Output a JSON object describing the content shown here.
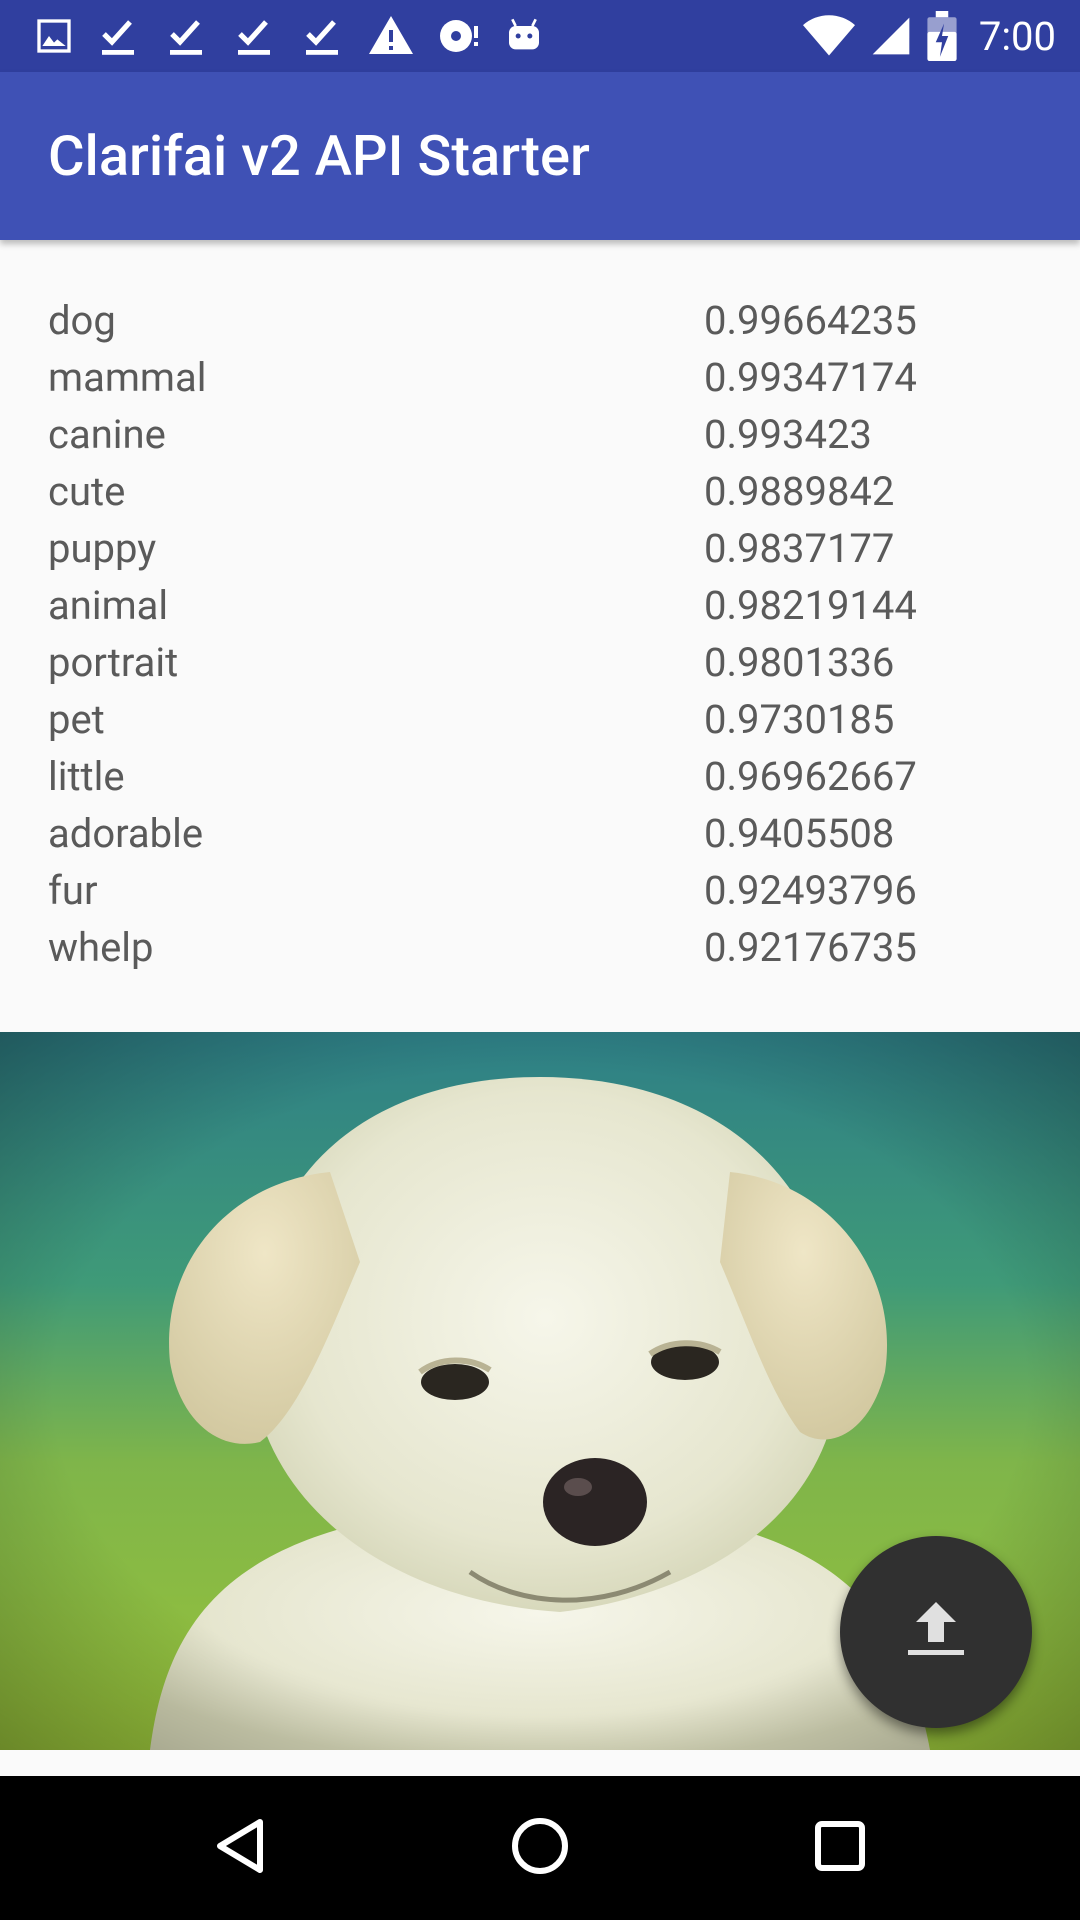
{
  "status_bar": {
    "time": "7:00",
    "left_icons": [
      "image-icon",
      "check-icon",
      "check-icon",
      "check-icon",
      "check-icon",
      "warning-icon",
      "disc-icon",
      "android-icon"
    ],
    "right_icons": [
      "wifi-icon",
      "signal-icon",
      "battery-icon"
    ]
  },
  "app_bar": {
    "title": "Clarifai v2 API Starter"
  },
  "predictions": [
    {
      "concept": "dog",
      "value": "0.99664235"
    },
    {
      "concept": "mammal",
      "value": "0.99347174"
    },
    {
      "concept": "canine",
      "value": "0.993423"
    },
    {
      "concept": "cute",
      "value": "0.9889842"
    },
    {
      "concept": "puppy",
      "value": "0.9837177"
    },
    {
      "concept": "animal",
      "value": "0.98219144"
    },
    {
      "concept": "portrait",
      "value": "0.9801336"
    },
    {
      "concept": "pet",
      "value": "0.9730185"
    },
    {
      "concept": "little",
      "value": "0.96962667"
    },
    {
      "concept": "adorable",
      "value": "0.9405508"
    },
    {
      "concept": "fur",
      "value": "0.92493796"
    },
    {
      "concept": "whelp",
      "value": "0.92176735"
    }
  ],
  "fab": {
    "icon": "upload-icon"
  },
  "nav_bar": {
    "icons": [
      "back-icon",
      "home-icon",
      "recents-icon"
    ]
  },
  "colors": {
    "status_bar": "#303f9f",
    "app_bar": "#3f51b5",
    "fab": "#303030"
  }
}
